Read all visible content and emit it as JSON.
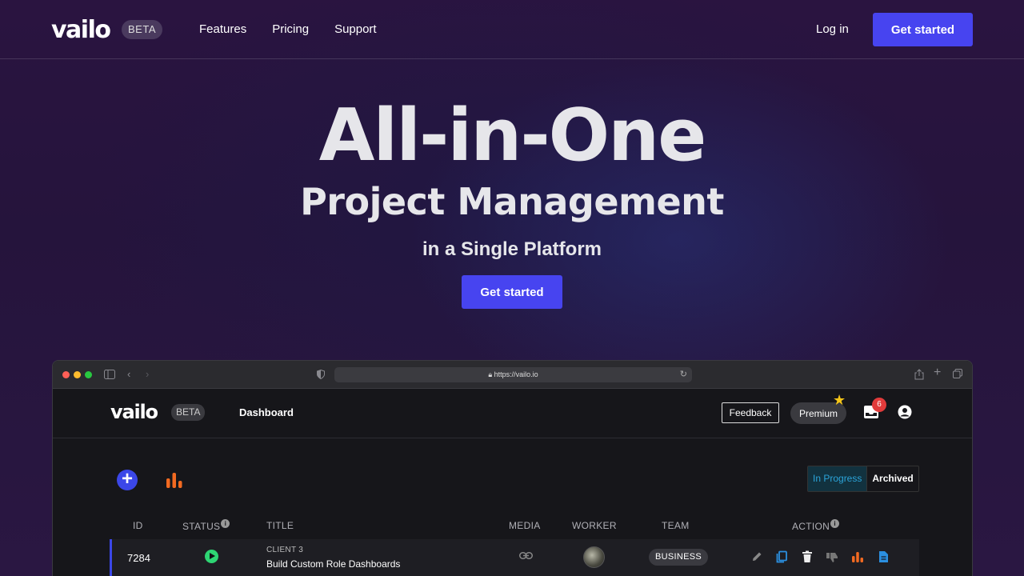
{
  "nav": {
    "logo": "vailo",
    "beta": "BETA",
    "links": [
      "Features",
      "Pricing",
      "Support"
    ],
    "login": "Log in",
    "cta": "Get started"
  },
  "hero": {
    "title": "All-in-One",
    "subtitle": "Project Management",
    "tagline": "in a Single Platform",
    "cta": "Get started"
  },
  "browser": {
    "url": "https://vailo.io"
  },
  "app": {
    "logo": "vailo",
    "beta": "BETA",
    "nav_item": "Dashboard",
    "feedback": "Feedback",
    "premium": "Premium",
    "inbox_count": "6",
    "filters": {
      "active": "In Progress",
      "inactive": "Archived"
    },
    "table": {
      "columns": [
        "ID",
        "STATUS",
        "TITLE",
        "MEDIA",
        "WORKER",
        "TEAM",
        "ACTION"
      ],
      "rows": [
        {
          "id": "7284",
          "status": "in-progress",
          "client": "CLIENT 3",
          "title": "Build Custom Role Dashboards",
          "media": "link-icon",
          "team": "BUSINESS"
        }
      ]
    }
  },
  "colors": {
    "accent": "#4744f0",
    "status_green": "#2ed573",
    "chart_orange": "#f26a21",
    "doc_blue": "#2b8fe0"
  }
}
